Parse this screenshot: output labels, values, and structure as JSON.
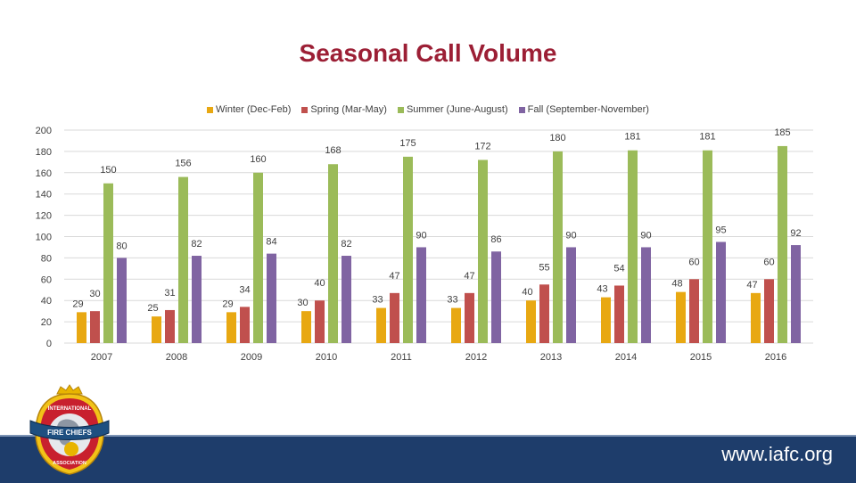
{
  "chart_data": {
    "type": "bar",
    "title": "Seasonal Call Volume",
    "xlabel": "",
    "ylabel": "",
    "ylim": [
      0,
      200
    ],
    "yticks": [
      0,
      20,
      40,
      60,
      80,
      100,
      120,
      140,
      160,
      180,
      200
    ],
    "grid": true,
    "legend_position": "top",
    "categories": [
      "2007",
      "2008",
      "2009",
      "2010",
      "2011",
      "2012",
      "2013",
      "2014",
      "2015",
      "2016"
    ],
    "series": [
      {
        "name": "Winter (Dec-Feb)",
        "color": "#e8a812",
        "values": [
          29,
          25,
          29,
          30,
          33,
          33,
          40,
          43,
          48,
          47
        ]
      },
      {
        "name": "Spring (Mar-May)",
        "color": "#c0504d",
        "values": [
          30,
          31,
          34,
          40,
          47,
          47,
          55,
          54,
          60,
          60
        ]
      },
      {
        "name": "Summer (June-August)",
        "color": "#9bbb59",
        "values": [
          150,
          156,
          160,
          168,
          175,
          172,
          180,
          181,
          181,
          185
        ]
      },
      {
        "name": "Fall (September-November)",
        "color": "#8064a2",
        "values": [
          80,
          82,
          84,
          82,
          90,
          86,
          90,
          90,
          95,
          92
        ]
      }
    ]
  },
  "footer": {
    "url": "www.iafc.org",
    "logo_alt": "International Fire Chiefs Association logo",
    "logo_top_text": "INTERNATIONAL",
    "logo_banner_text": "FIRE CHIEFS",
    "logo_bottom_text": "ASSOCIATION"
  },
  "colors": {
    "title": "#9c1f35",
    "footer_band": "#1e3d6b",
    "gridline": "#d9d9d9"
  }
}
